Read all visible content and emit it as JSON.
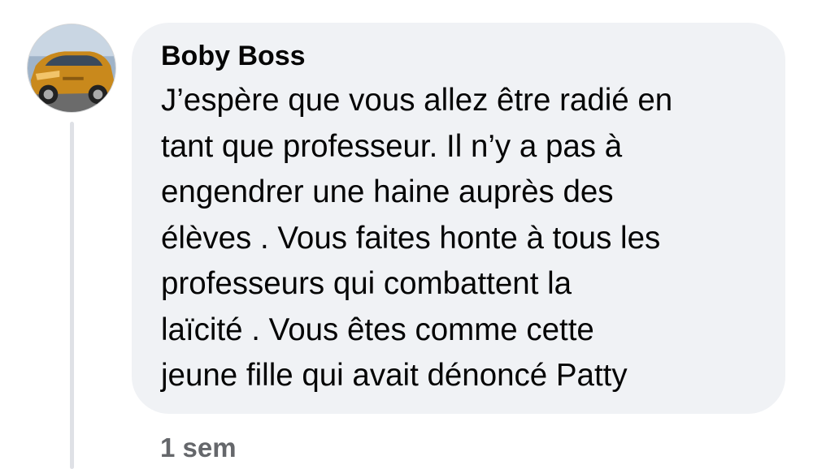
{
  "comment": {
    "author": "Boby Boss",
    "avatar_icon": "car-photo-avatar",
    "text": "J’espère que vous allez être radié en\ntant que professeur. Il n’y a pas à\nengendrer une haine auprès des\nélèves . Vous faites honte à tous les\nprofesseurs qui combattent la\nlaïcité . Vous êtes comme cette\njeune fille qui avait dénoncé Patty",
    "timestamp": "1 sem"
  },
  "colors": {
    "bubble_background": "#f0f2f5",
    "text": "#050505",
    "secondary_text": "#65676b",
    "thread_line": "#dfe1e6"
  }
}
